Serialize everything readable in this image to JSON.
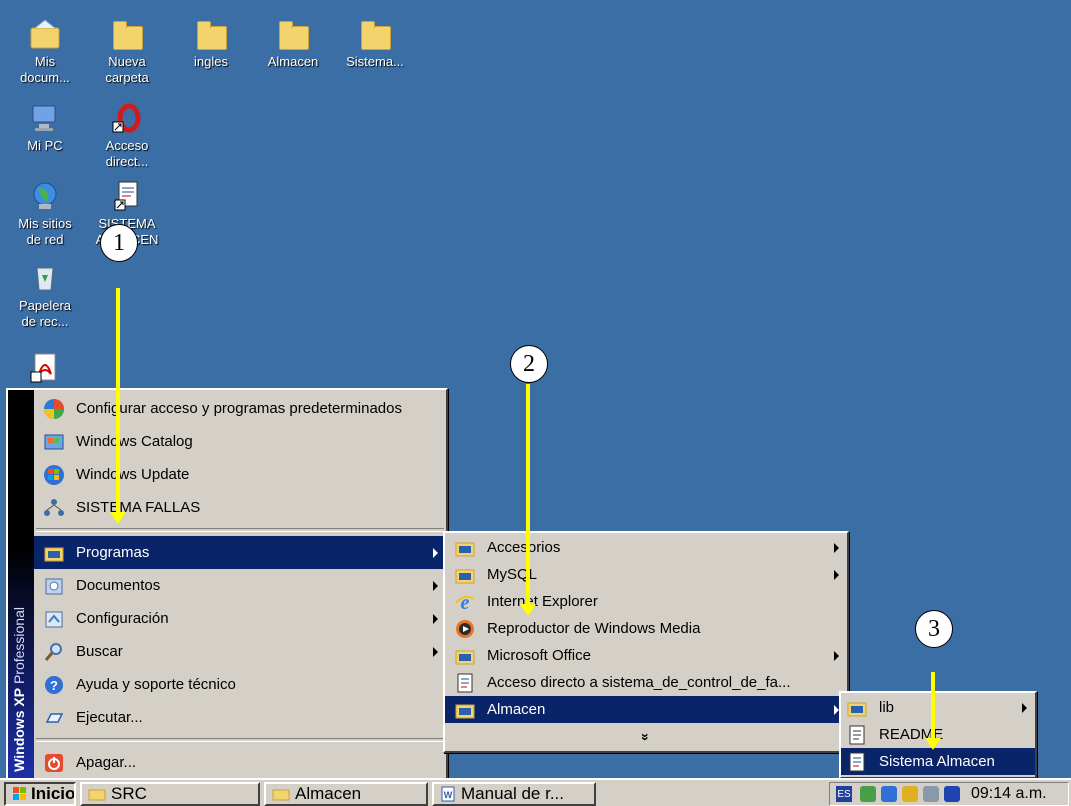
{
  "desktop": {
    "icons": [
      {
        "label": "Mis\ndocum..."
      },
      {
        "label": "Nueva\ncarpeta"
      },
      {
        "label": "ingles"
      },
      {
        "label": "Almacen"
      },
      {
        "label": "Sistema..."
      },
      {
        "label": "Mi PC"
      },
      {
        "label": "Acceso\ndirect..."
      },
      {
        "label": "Mis sitios\nde red"
      },
      {
        "label": "SISTEMA\nALMACEN"
      },
      {
        "label": "Papelera\nde rec..."
      }
    ]
  },
  "start_menu": {
    "banner_bold": "Windows XP",
    "banner_thin": "Professional",
    "items": [
      {
        "label": "Configurar acceso y programas predeterminados"
      },
      {
        "label": "Windows Catalog"
      },
      {
        "label": "Windows Update"
      },
      {
        "label": "SISTEMA FALLAS"
      },
      {
        "label": "Programas"
      },
      {
        "label": "Documentos"
      },
      {
        "label": "Configuración"
      },
      {
        "label": "Buscar"
      },
      {
        "label": "Ayuda y soporte técnico"
      },
      {
        "label": "Ejecutar..."
      },
      {
        "label": "Apagar..."
      }
    ]
  },
  "programs_menu": {
    "items": [
      {
        "label": "Accesorios"
      },
      {
        "label": "MySQL"
      },
      {
        "label": "Internet Explorer"
      },
      {
        "label": "Reproductor de Windows Media"
      },
      {
        "label": "Microsoft Office"
      },
      {
        "label": "Acceso directo a sistema_de_control_de_fa..."
      },
      {
        "label": "Almacen"
      }
    ],
    "more": "»"
  },
  "almacen_menu": {
    "items": [
      {
        "label": "lib"
      },
      {
        "label": "README"
      },
      {
        "label": "Sistema Almacen"
      }
    ]
  },
  "taskbar": {
    "start_label": "Inicio",
    "buttons": [
      {
        "label": "SRC"
      },
      {
        "label": "Almacen"
      },
      {
        "label": "Manual de r..."
      }
    ],
    "lang": "ES",
    "clock": "09:14 a.m."
  },
  "annotations": {
    "one": "1",
    "two": "2",
    "three": "3"
  },
  "colors": {
    "desktop": "#3a6ea5",
    "menu": "#d4d0c8",
    "selection": "#0a246a",
    "annotation_arrow": "#ffff00"
  }
}
